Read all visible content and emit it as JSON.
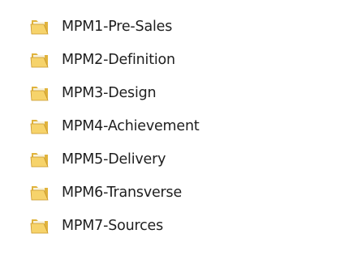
{
  "icons": {
    "folder": "folder-icon"
  },
  "colors": {
    "folder_back": "#e0b33c",
    "folder_front": "#f6d36b",
    "folder_paper": "#f8f3df",
    "text": "#1e1e1e"
  },
  "folders": [
    {
      "label": "MPM1-Pre-Sales"
    },
    {
      "label": "MPM2-Definition"
    },
    {
      "label": "MPM3-Design"
    },
    {
      "label": "MPM4-Achievement"
    },
    {
      "label": "MPM5-Delivery"
    },
    {
      "label": "MPM6-Transverse"
    },
    {
      "label": "MPM7-Sources"
    }
  ]
}
